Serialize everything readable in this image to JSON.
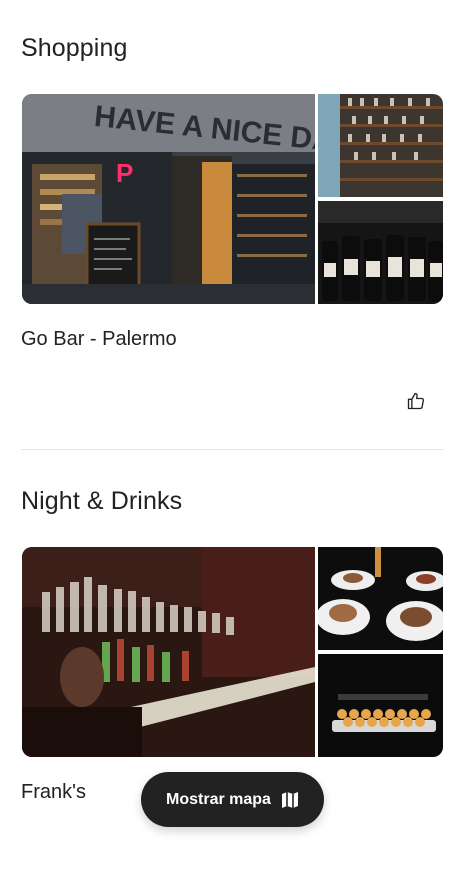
{
  "sections": [
    {
      "title": "Shopping",
      "place": {
        "name": "Go Bar - Palermo"
      }
    },
    {
      "title": "Night & Drinks",
      "place": {
        "name": "Frank's"
      }
    }
  ],
  "photo_text": {
    "sign": "HAVE A NICE DAY!"
  },
  "map_button": {
    "label": "Mostrar mapa",
    "icon": "map-icon"
  },
  "like_icon": "thumbs-up-icon",
  "colors": {
    "text": "#222222",
    "button_bg": "#222222",
    "divider": "#e6e6e6"
  }
}
